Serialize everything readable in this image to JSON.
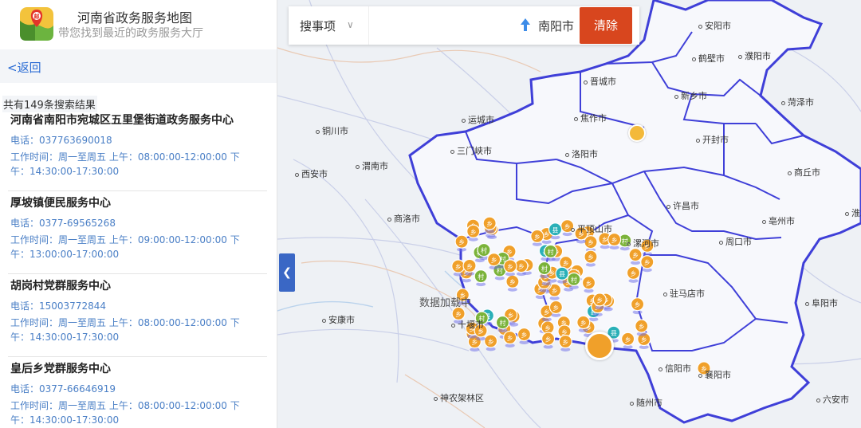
{
  "app": {
    "title": "河南省政务服务地图",
    "subtitle": "带您找到最近的政务服务大厅",
    "logo_glyph": "邮"
  },
  "nav": {
    "back_label": "<返回"
  },
  "results": {
    "count_text": "共有149条搜索结果",
    "items": [
      {
        "name": "河南省南阳市宛城区五里堡街道政务服务中心",
        "phone": "电话：037763690018",
        "hours": "工作时间：周一至周五 上午：08:00:00-12:00:00 下午：14:30:00-17:30:00"
      },
      {
        "name": "厚坡镇便民服务中心",
        "phone": "电话：0377-69565268",
        "hours": "工作时间：周一至周五 上午：09:00:00-12:00:00 下午：13:00:00-17:00:00"
      },
      {
        "name": "胡岗村党群服务中心",
        "phone": "电话：15003772844",
        "hours": "工作时间：周一至周五 上午：08:00:00-12:00:00 下午：14:30:00-17:30:00"
      },
      {
        "name": "皇后乡党群服务中心",
        "phone": "电话：0377-66646919",
        "hours": "工作时间：周一至周五 上午：08:00:00-12:00:00 下午：14:30:00-17:30:00"
      }
    ]
  },
  "search": {
    "type_label": "搜事项",
    "input_value": "",
    "input_placeholder": "",
    "city_label": "南阳市",
    "clear_label": "清除"
  },
  "map": {
    "loading_text": "数据加载中",
    "colors": {
      "border": "#3f3fd8",
      "province_fill": "#f7f8fc",
      "orange": "#f0a02a",
      "green": "#7bb33a",
      "teal": "#2ab0b8"
    },
    "cities": [
      {
        "name": "安阳市"
      },
      {
        "name": "鹤壁市"
      },
      {
        "name": "濮阳市"
      },
      {
        "name": "晋城市"
      },
      {
        "name": "新乡市"
      },
      {
        "name": "焦作市"
      },
      {
        "name": "菏泽市"
      },
      {
        "name": "运城市"
      },
      {
        "name": "铜川市"
      },
      {
        "name": "三门峡市"
      },
      {
        "name": "洛阳市"
      },
      {
        "name": "开封市"
      },
      {
        "name": "渭南市"
      },
      {
        "name": "西安市"
      },
      {
        "name": "商丘市"
      },
      {
        "name": "商洛市"
      },
      {
        "name": "许昌市"
      },
      {
        "name": "平顶山市"
      },
      {
        "name": "淮北"
      },
      {
        "name": "亳州市"
      },
      {
        "name": "漯河市"
      },
      {
        "name": "周口市"
      },
      {
        "name": "驻马店市"
      },
      {
        "name": "十堰市"
      },
      {
        "name": "安康市"
      },
      {
        "name": "阜阳市"
      },
      {
        "name": "襄阳市"
      },
      {
        "name": "信阳市"
      },
      {
        "name": "神农架林区"
      },
      {
        "name": "随州市"
      },
      {
        "name": "六安市"
      }
    ],
    "marker_labels": {
      "township": "乡",
      "village": "村",
      "county": "县"
    }
  }
}
